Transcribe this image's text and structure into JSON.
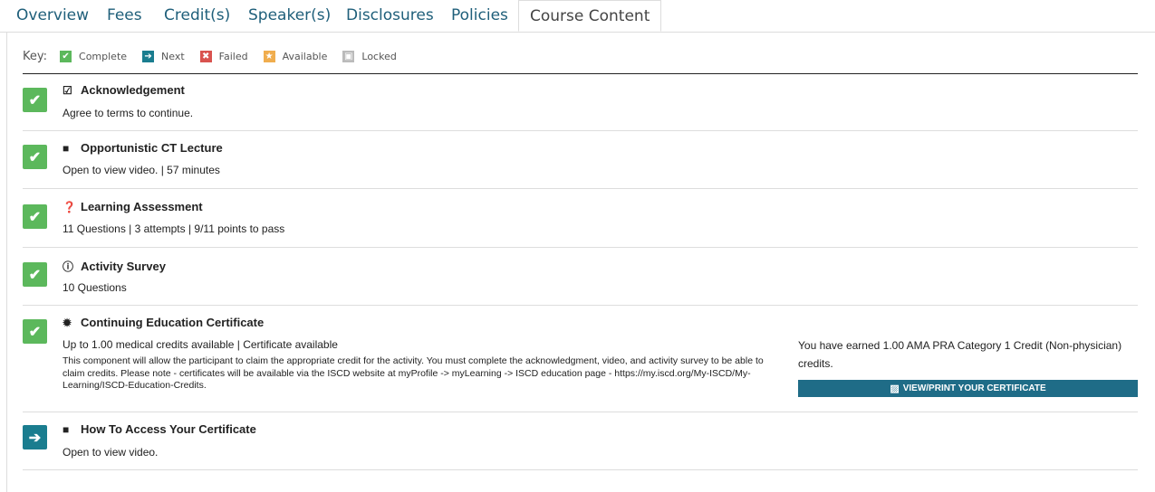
{
  "tabs": [
    {
      "label": "Overview"
    },
    {
      "label": "Fees"
    },
    {
      "label": "Credit(s)"
    },
    {
      "label": "Speaker(s)"
    },
    {
      "label": "Disclosures"
    },
    {
      "label": "Policies"
    },
    {
      "label": "Course Content",
      "active": true
    }
  ],
  "key": {
    "label": "Key:",
    "items": [
      {
        "label": "Complete",
        "icon": "check-icon",
        "color": "#5cb85c"
      },
      {
        "label": "Next",
        "icon": "arrow-right-icon",
        "color": "#1a7d8f"
      },
      {
        "label": "Failed",
        "icon": "x-icon",
        "color": "#d9534f"
      },
      {
        "label": "Available",
        "icon": "star-icon",
        "color": "#f0ad4e"
      },
      {
        "label": "Locked",
        "icon": "lock-icon",
        "color": "#bbbbbb"
      }
    ]
  },
  "items": [
    {
      "title": "Acknowledgement",
      "icon": "checkbox-icon",
      "status": "complete",
      "meta": "Agree to terms to continue."
    },
    {
      "title": "Opportunistic CT Lecture",
      "icon": "video-icon",
      "status": "complete",
      "meta": "Open to view video.  |  57 minutes"
    },
    {
      "title": "Learning Assessment",
      "icon": "question-icon",
      "status": "complete",
      "meta": "11 Questions  |  3 attempts  |  9/11 points to pass"
    },
    {
      "title": "Activity Survey",
      "icon": "info-icon",
      "status": "complete",
      "meta": "10 Questions"
    },
    {
      "title": "Continuing Education Certificate",
      "icon": "certificate-icon",
      "status": "complete",
      "meta": "Up to 1.00 medical credits available  |  Certificate available",
      "description": "This component will allow the participant to claim the appropriate credit for the activity. You must complete the acknowledgment, video, and activity survey to be able to claim credits. Please note - certificates will be available via the ISCD website at myProfile -> myLearning -> ISCD education page - https://my.iscd.org/My-ISCD/My-Learning/ISCD-Education-Credits.",
      "earned": "You have earned 1.00 AMA PRA Category 1 Credit (Non-physician) credits.",
      "button": "VIEW/PRINT YOUR CERTIFICATE"
    },
    {
      "title": "How To Access Your Certificate",
      "icon": "video-icon",
      "status": "next",
      "meta": "Open to view video."
    }
  ],
  "colors": {
    "complete": "#5cb85c",
    "next": "#1a7d8f",
    "tab_link": "#1f5f7a",
    "button": "#1f6c87"
  }
}
